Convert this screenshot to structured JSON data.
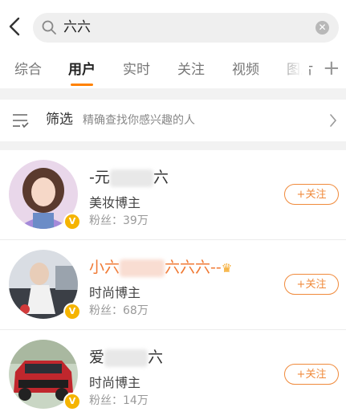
{
  "search": {
    "query": "六六"
  },
  "tabs": [
    {
      "label": "综合"
    },
    {
      "label": "用户"
    },
    {
      "label": "实时"
    },
    {
      "label": "关注"
    },
    {
      "label": "视频"
    },
    {
      "label": "图片"
    }
  ],
  "filter": {
    "title": "筛选",
    "description": "精确查找你感兴趣的人"
  },
  "users": [
    {
      "name_prefix": "-元",
      "name_suffix": "六",
      "type": "美妆博主",
      "fans": "粉丝：39万",
      "follow_label": "+关注",
      "verified_badge": "V"
    },
    {
      "name_prefix": "小六",
      "name_suffix": "六六六--",
      "type": "时尚博主",
      "fans": "粉丝：68万",
      "follow_label": "+关注",
      "verified_badge": "V"
    },
    {
      "name_prefix": "爱",
      "name_suffix": "六",
      "type": "时尚博主",
      "fans": "粉丝：14万",
      "follow_label": "+关注",
      "verified_badge": "V"
    }
  ],
  "colors": {
    "accent": "#ff8200",
    "follow": "#f08a3b",
    "badge": "#f5b400",
    "name_highlight": "#f07a35"
  }
}
